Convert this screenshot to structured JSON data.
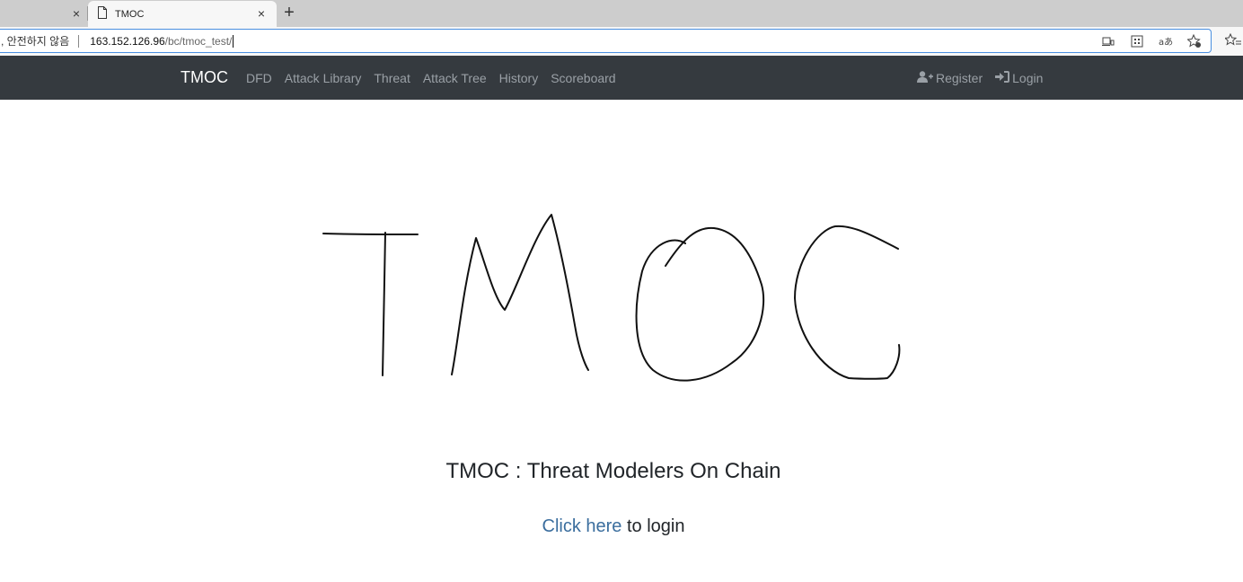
{
  "browser": {
    "tabs": [
      {
        "title": "",
        "active": false
      },
      {
        "title": "TMOC",
        "active": true
      }
    ],
    "close_glyph": "×",
    "newtab_glyph": "+",
    "address": {
      "security_label": ", 안전하지 않음",
      "url_host": "163.152.126.96",
      "url_path": "/bc/tmoc_test/"
    },
    "toolbar_icons": [
      "reader-view-icon",
      "app-available-icon",
      "read-aloud-icon",
      "add-favorite-icon",
      "favorites-list-icon"
    ]
  },
  "navbar": {
    "brand": "TMOC",
    "links": [
      "DFD",
      "Attack Library",
      "Threat",
      "Attack Tree",
      "History",
      "Scoreboard"
    ],
    "register": "Register",
    "login": "Login"
  },
  "main": {
    "logo_text": "TMOC",
    "tagline": "TMOC : Threat Modelers On Chain",
    "login_link": "Click here",
    "login_suffix": " to login"
  },
  "colors": {
    "navbar_bg": "#353a3f",
    "link": "#3b6e9e",
    "nav_text": "#9aa0a6"
  }
}
